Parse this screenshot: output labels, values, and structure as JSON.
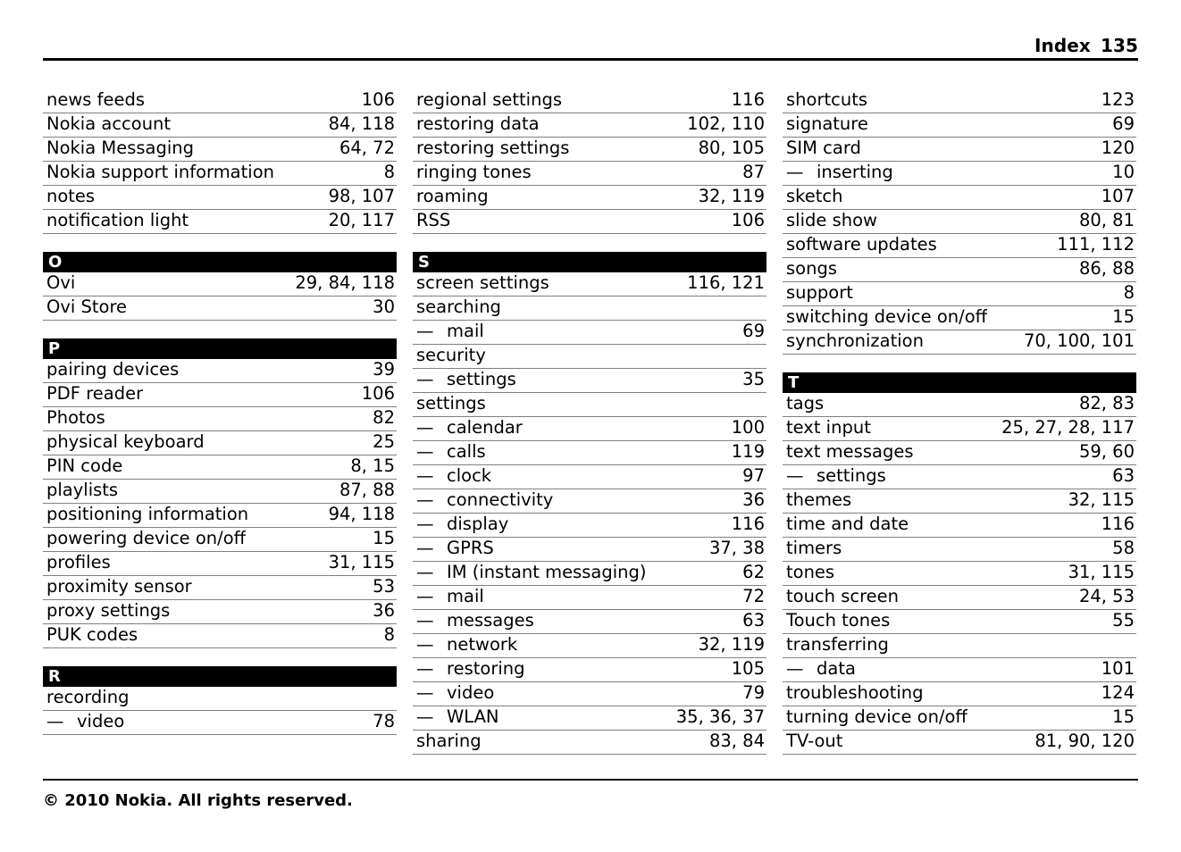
{
  "header": {
    "label": "Index",
    "page_number": "135"
  },
  "footer": {
    "copyright": "© 2010 Nokia. All rights reserved."
  },
  "columns": [
    {
      "id": "column-1",
      "blocks": [
        {
          "type": "entries",
          "entries": [
            {
              "term": "news feeds",
              "pages": "106",
              "sub": false
            },
            {
              "term": "Nokia account",
              "pages": "84, 118",
              "sub": false
            },
            {
              "term": "Nokia Messaging",
              "pages": "64, 72",
              "sub": false
            },
            {
              "term": "Nokia support information",
              "pages": "8",
              "sub": false
            },
            {
              "term": "notes",
              "pages": "98, 107",
              "sub": false
            },
            {
              "term": "notification light",
              "pages": "20, 117",
              "sub": false
            }
          ]
        },
        {
          "type": "section",
          "letter": "O",
          "entries": [
            {
              "term": "Ovi",
              "pages": "29, 84, 118",
              "sub": false
            },
            {
              "term": "Ovi Store",
              "pages": "30",
              "sub": false
            }
          ]
        },
        {
          "type": "section",
          "letter": "P",
          "entries": [
            {
              "term": "pairing devices",
              "pages": "39",
              "sub": false
            },
            {
              "term": "PDF reader",
              "pages": "106",
              "sub": false
            },
            {
              "term": "Photos",
              "pages": "82",
              "sub": false
            },
            {
              "term": "physical keyboard",
              "pages": "25",
              "sub": false
            },
            {
              "term": "PIN code",
              "pages": "8, 15",
              "sub": false
            },
            {
              "term": "playlists",
              "pages": "87, 88",
              "sub": false
            },
            {
              "term": "positioning information",
              "pages": "94, 118",
              "sub": false
            },
            {
              "term": "powering device on/off",
              "pages": "15",
              "sub": false
            },
            {
              "term": "profiles",
              "pages": "31, 115",
              "sub": false
            },
            {
              "term": "proximity sensor",
              "pages": "53",
              "sub": false
            },
            {
              "term": "proxy settings",
              "pages": "36",
              "sub": false
            },
            {
              "term": "PUK codes",
              "pages": "8",
              "sub": false
            }
          ]
        },
        {
          "type": "section",
          "letter": "R",
          "entries": [
            {
              "term": "recording",
              "pages": "",
              "sub": false
            },
            {
              "term": "video",
              "pages": "78",
              "sub": true
            }
          ]
        }
      ]
    },
    {
      "id": "column-2",
      "blocks": [
        {
          "type": "entries",
          "entries": [
            {
              "term": "regional settings",
              "pages": "116",
              "sub": false
            },
            {
              "term": "restoring data",
              "pages": "102, 110",
              "sub": false
            },
            {
              "term": "restoring settings",
              "pages": "80, 105",
              "sub": false
            },
            {
              "term": "ringing tones",
              "pages": "87",
              "sub": false
            },
            {
              "term": "roaming",
              "pages": "32, 119",
              "sub": false
            },
            {
              "term": "RSS",
              "pages": "106",
              "sub": false
            }
          ]
        },
        {
          "type": "section",
          "letter": "S",
          "entries": [
            {
              "term": "screen settings",
              "pages": "116, 121",
              "sub": false
            },
            {
              "term": "searching",
              "pages": "",
              "sub": false
            },
            {
              "term": "mail",
              "pages": "69",
              "sub": true
            },
            {
              "term": "security",
              "pages": "",
              "sub": false
            },
            {
              "term": "settings",
              "pages": "35",
              "sub": true
            },
            {
              "term": "settings",
              "pages": "",
              "sub": false
            },
            {
              "term": "calendar",
              "pages": "100",
              "sub": true
            },
            {
              "term": "calls",
              "pages": "119",
              "sub": true
            },
            {
              "term": "clock",
              "pages": "97",
              "sub": true
            },
            {
              "term": "connectivity",
              "pages": "36",
              "sub": true
            },
            {
              "term": "display",
              "pages": "116",
              "sub": true
            },
            {
              "term": "GPRS",
              "pages": "37, 38",
              "sub": true
            },
            {
              "term": "IM (instant messaging)",
              "pages": "62",
              "sub": true
            },
            {
              "term": "mail",
              "pages": "72",
              "sub": true
            },
            {
              "term": "messages",
              "pages": "63",
              "sub": true
            },
            {
              "term": "network",
              "pages": "32, 119",
              "sub": true
            },
            {
              "term": "restoring",
              "pages": "105",
              "sub": true
            },
            {
              "term": "video",
              "pages": "79",
              "sub": true
            },
            {
              "term": "WLAN",
              "pages": "35, 36, 37",
              "sub": true
            },
            {
              "term": "sharing",
              "pages": "83, 84",
              "sub": false
            }
          ]
        }
      ]
    },
    {
      "id": "column-3",
      "blocks": [
        {
          "type": "entries",
          "entries": [
            {
              "term": "shortcuts",
              "pages": "123",
              "sub": false
            },
            {
              "term": "signature",
              "pages": "69",
              "sub": false
            },
            {
              "term": "SIM card",
              "pages": "120",
              "sub": false
            },
            {
              "term": "inserting",
              "pages": "10",
              "sub": true
            },
            {
              "term": "sketch",
              "pages": "107",
              "sub": false
            },
            {
              "term": "slide show",
              "pages": "80, 81",
              "sub": false
            },
            {
              "term": "software updates",
              "pages": "111, 112",
              "sub": false
            },
            {
              "term": "songs",
              "pages": "86, 88",
              "sub": false
            },
            {
              "term": "support",
              "pages": "8",
              "sub": false
            },
            {
              "term": "switching device on/off",
              "pages": "15",
              "sub": false
            },
            {
              "term": "synchronization",
              "pages": "70, 100, 101",
              "sub": false
            }
          ]
        },
        {
          "type": "section",
          "letter": "T",
          "entries": [
            {
              "term": "tags",
              "pages": "82, 83",
              "sub": false
            },
            {
              "term": "text input",
              "pages": "25, 27, 28, 117",
              "sub": false
            },
            {
              "term": "text messages",
              "pages": "59, 60",
              "sub": false
            },
            {
              "term": "settings",
              "pages": "63",
              "sub": true
            },
            {
              "term": "themes",
              "pages": "32, 115",
              "sub": false
            },
            {
              "term": "time and date",
              "pages": "116",
              "sub": false
            },
            {
              "term": "timers",
              "pages": "58",
              "sub": false
            },
            {
              "term": "tones",
              "pages": "31, 115",
              "sub": false
            },
            {
              "term": "touch screen",
              "pages": "24, 53",
              "sub": false
            },
            {
              "term": "Touch tones",
              "pages": "55",
              "sub": false
            },
            {
              "term": "transferring",
              "pages": "",
              "sub": false
            },
            {
              "term": "data",
              "pages": "101",
              "sub": true
            },
            {
              "term": "troubleshooting",
              "pages": "124",
              "sub": false
            },
            {
              "term": "turning device on/off",
              "pages": "15",
              "sub": false
            },
            {
              "term": "TV-out",
              "pages": "81, 90, 120",
              "sub": false
            }
          ]
        }
      ]
    }
  ],
  "glyphs": {
    "em_dash": "—"
  }
}
